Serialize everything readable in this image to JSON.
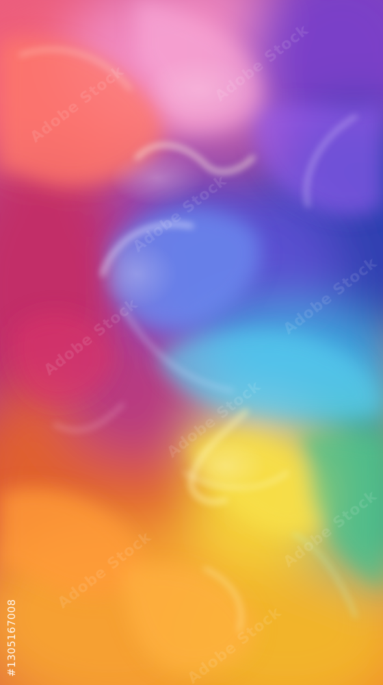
{
  "image": {
    "subject": "abstract flowing silk fabric",
    "colors": {
      "magenta": "#e63a7a",
      "pink": "#f28ab4",
      "purple": "#8a4fd8",
      "blue": "#3f5fd6",
      "cyan": "#4cc6e8",
      "green": "#5fbf6a",
      "yellow": "#f4d23a",
      "orange": "#f18a2a",
      "red": "#e2432f"
    }
  },
  "watermark": {
    "brand": "Adobe Stock",
    "stock_number": "#1305167008"
  }
}
